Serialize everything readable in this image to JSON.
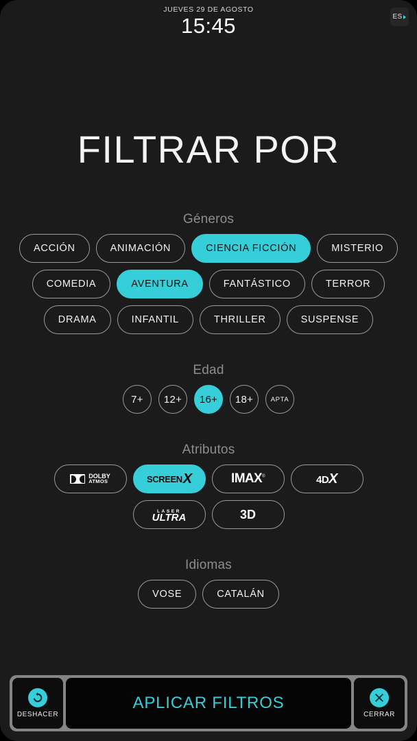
{
  "statusbar": {
    "date": "JUEVES 29 DE AGOSTO",
    "time": "15:45",
    "language": "ES"
  },
  "page_title": "FILTRAR POR",
  "sections": {
    "generos": {
      "title": "Géneros",
      "rows": [
        [
          {
            "label": "ACCIÓN",
            "selected": false
          },
          {
            "label": "ANIMACIÓN",
            "selected": false
          },
          {
            "label": "CIENCIA FICCIÓN",
            "selected": true
          },
          {
            "label": "MISTERIO",
            "selected": false
          }
        ],
        [
          {
            "label": "COMEDIA",
            "selected": false
          },
          {
            "label": "AVENTURA",
            "selected": true
          },
          {
            "label": "FANTÁSTICO",
            "selected": false
          },
          {
            "label": "TERROR",
            "selected": false
          }
        ],
        [
          {
            "label": "DRAMA",
            "selected": false
          },
          {
            "label": "INFANTIL",
            "selected": false
          },
          {
            "label": "THRILLER",
            "selected": false
          },
          {
            "label": "SUSPENSE",
            "selected": false
          }
        ]
      ]
    },
    "edad": {
      "title": "Edad",
      "options": [
        {
          "label": "7+",
          "selected": false
        },
        {
          "label": "12+",
          "selected": false
        },
        {
          "label": "16+",
          "selected": true
        },
        {
          "label": "18+",
          "selected": false
        },
        {
          "label": "APTA",
          "selected": false
        }
      ]
    },
    "atributos": {
      "title": "Atributos",
      "row1": [
        {
          "id": "dolby-atmos",
          "line1": "DOLBY",
          "line2": "ATMOS",
          "selected": false
        },
        {
          "id": "screenx",
          "line1": "SCREEN",
          "line2": "X",
          "selected": true
        },
        {
          "id": "imax",
          "line1": "IMAX",
          "line2": "®",
          "selected": false
        },
        {
          "id": "4dx",
          "line1": "4D",
          "line2": "X",
          "selected": false
        }
      ],
      "row2": [
        {
          "id": "laser-ultra",
          "line1": "LASER",
          "line2": "ULTRA",
          "selected": false
        },
        {
          "id": "3d",
          "line1": "3D",
          "line2": "",
          "selected": false
        }
      ]
    },
    "idiomas": {
      "title": "Idiomas",
      "options": [
        {
          "label": "VOSE",
          "selected": false
        },
        {
          "label": "CATALÁN",
          "selected": false
        }
      ]
    }
  },
  "bottombar": {
    "undo_label": "DESHACER",
    "apply_label": "APLICAR FILTROS",
    "close_label": "CERRAR"
  },
  "colors": {
    "accent": "#35ced9",
    "background": "#1b1b1b",
    "section_title": "#8d8d8d"
  }
}
